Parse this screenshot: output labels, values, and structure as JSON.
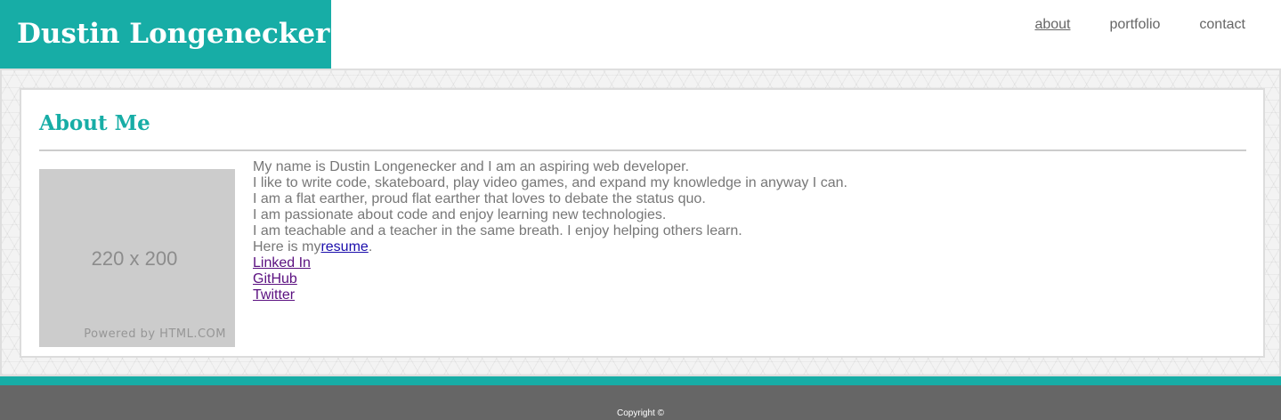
{
  "header": {
    "brand": "Dustin Longenecker",
    "nav": [
      {
        "label": "about",
        "active": true
      },
      {
        "label": "portfolio",
        "active": false
      },
      {
        "label": "contact",
        "active": false
      }
    ]
  },
  "main": {
    "title": "About Me",
    "image": {
      "dimensions_label": "220 x 200",
      "powered_by": "Powered by HTML.COM"
    },
    "bio_lines": [
      "My name is Dustin Longenecker and I am an aspiring web developer.",
      "I like to write code, skateboard, play video games, and expand my knowledge in anyway I can.",
      "I am a flat earther, proud flat earther that loves to debate the status quo.",
      "I am passionate about code and enjoy learning new technologies.",
      "I am teachable and a teacher in the same breath. I enjoy helping others learn."
    ],
    "resume_prefix": "Here is my",
    "resume_link": "resume",
    "resume_suffix": ".",
    "links": [
      "Linked In",
      "GitHub",
      "Twitter"
    ]
  },
  "footer": {
    "copyright": "Copyright ©"
  },
  "colors": {
    "accent": "#17ada6",
    "footer": "#666666",
    "text": "#777777"
  }
}
